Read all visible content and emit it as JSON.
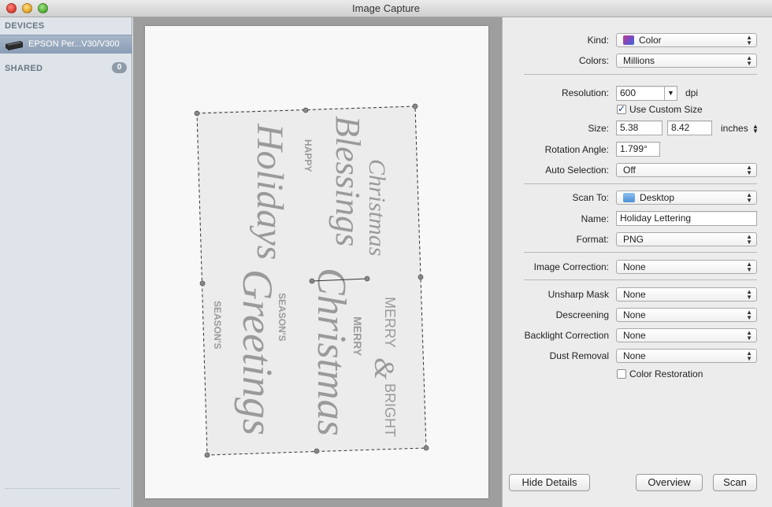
{
  "window": {
    "title": "Image Capture"
  },
  "sidebar": {
    "devices_header": "DEVICES",
    "device_name": "EPSON Per...V30/V300",
    "shared_header": "SHARED",
    "shared_count": "0"
  },
  "preview": {
    "lettering": {
      "christmas_blessings_1": "Christmas",
      "christmas_blessings_2": "Blessings",
      "happy": "HAPPY",
      "holidays": "Holidays",
      "christmas_2": "Christmas",
      "merry_1": "MERRY",
      "seasons_1": "SEASON'S",
      "greetings": "Greetings",
      "seasons_2": "SEASON'S",
      "merry_2": "MERRY",
      "ampersand": "&",
      "bright": "BRIGHT"
    }
  },
  "settings": {
    "kind_label": "Kind:",
    "kind_value": "Color",
    "colors_label": "Colors:",
    "colors_value": "Millions",
    "resolution_label": "Resolution:",
    "resolution_value": "600",
    "resolution_unit": "dpi",
    "custom_size_label": "Use Custom Size",
    "custom_size_checked": true,
    "size_label": "Size:",
    "size_width": "5.38",
    "size_height": "8.42",
    "size_unit": "inches",
    "rotation_label": "Rotation Angle:",
    "rotation_value": "1.799°",
    "auto_selection_label": "Auto Selection:",
    "auto_selection_value": "Off",
    "scan_to_label": "Scan To:",
    "scan_to_value": "Desktop",
    "name_label": "Name:",
    "name_value": "Holiday Lettering",
    "format_label": "Format:",
    "format_value": "PNG",
    "image_correction_label": "Image Correction:",
    "image_correction_value": "None",
    "unsharp_mask_label": "Unsharp Mask",
    "unsharp_mask_value": "None",
    "descreening_label": "Descreening",
    "descreening_value": "None",
    "backlight_label": "Backlight Correction",
    "backlight_value": "None",
    "dust_removal_label": "Dust Removal",
    "dust_removal_value": "None",
    "color_restoration_label": "Color Restoration",
    "color_restoration_checked": false
  },
  "buttons": {
    "hide_details": "Hide Details",
    "overview": "Overview",
    "scan": "Scan"
  }
}
